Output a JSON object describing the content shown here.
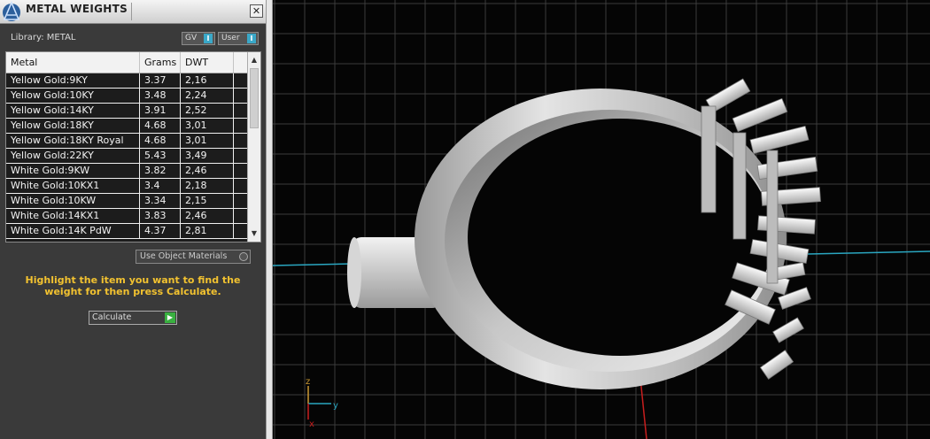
{
  "panel": {
    "title": "METAL WEIGHTS",
    "close_glyph": "✕",
    "library_label": "Library: METAL",
    "toggles": [
      {
        "label": "GV",
        "indicator": "I"
      },
      {
        "label": "User",
        "indicator": "I"
      }
    ],
    "table": {
      "columns": [
        "Metal",
        "Grams",
        "DWT"
      ],
      "rows": [
        [
          "Yellow Gold:9KY",
          "3.37",
          "2,16"
        ],
        [
          "Yellow Gold:10KY",
          "3.48",
          "2,24"
        ],
        [
          "Yellow Gold:14KY",
          "3.91",
          "2,52"
        ],
        [
          "Yellow Gold:18KY",
          "4.68",
          "3,01"
        ],
        [
          "Yellow Gold:18KY Royal",
          "4.68",
          "3,01"
        ],
        [
          "Yellow Gold:22KY",
          "5.43",
          "3,49"
        ],
        [
          "White Gold:9KW",
          "3.82",
          "2,46"
        ],
        [
          "White Gold:10KX1",
          "3.4",
          "2,18"
        ],
        [
          "White Gold:10KW",
          "3.34",
          "2,15"
        ],
        [
          "White Gold:14KX1",
          "3.83",
          "2,46"
        ],
        [
          "White Gold:14K PdW",
          "4.37",
          "2,81"
        ]
      ]
    },
    "use_object_materials": "Use Object Materials",
    "hint": "Highlight the item you want to find the weight for then press Calculate.",
    "calculate_label": "Calculate"
  },
  "viewport": {
    "axis_labels": {
      "z": "z",
      "y": "y",
      "x": "x"
    }
  },
  "icons": [
    "app-logo-icon",
    "close-icon",
    "scroll-up-icon",
    "scroll-down-icon",
    "play-icon"
  ],
  "colors": {
    "hint_text": "#f2c230",
    "indicator": "#3aa8c8",
    "grid_line": "#3c3c3c",
    "x_axis": "#c81e1e",
    "y_axis": "#2aa6c0"
  }
}
